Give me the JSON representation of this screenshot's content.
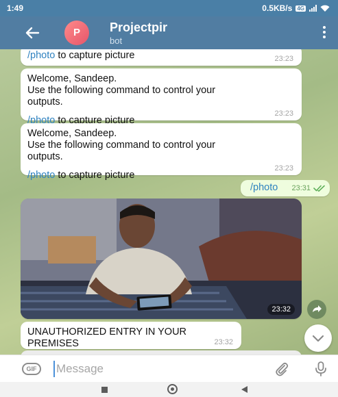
{
  "status_bar": {
    "time": "1:49",
    "network_speed": "0.5KB/s",
    "network_badge": "4G",
    "bg_color": "#4a7fa6"
  },
  "header": {
    "avatar_letter": "P",
    "title": "Projectpir",
    "subtitle": "bot",
    "bg_color": "#517da2"
  },
  "messages": [
    {
      "type": "incoming",
      "lines": [
        {
          "command": "/photo",
          "text": " to capture picture"
        }
      ],
      "time": "23:23"
    },
    {
      "type": "incoming",
      "greeting": "Welcome, Sandeep.",
      "body_1": "Use the following command to control your",
      "body_2": "outputs.",
      "command": "/photo",
      "command_text": " to capture picture",
      "time": "23:23"
    },
    {
      "type": "incoming",
      "greeting": "Welcome, Sandeep.",
      "body_1": "Use the following command to control your",
      "body_2": "outputs.",
      "command": "/photo",
      "command_text": " to capture picture",
      "time": "23:23"
    },
    {
      "type": "outgoing",
      "text": "/photo",
      "time": "23:31",
      "status_icon": "double-check-icon"
    },
    {
      "type": "photo",
      "time": "23:32"
    },
    {
      "type": "incoming",
      "line_1": "UNAUTHORIZED ENTRY IN YOUR",
      "line_2": "PREMISES",
      "time": "23:32"
    }
  ],
  "input": {
    "gif_label": "GIF",
    "placeholder": "Message"
  },
  "colors": {
    "command_link": "#2f82c0",
    "outgoing_bubble": "#effdde",
    "wallpaper": "#a4bb86"
  }
}
